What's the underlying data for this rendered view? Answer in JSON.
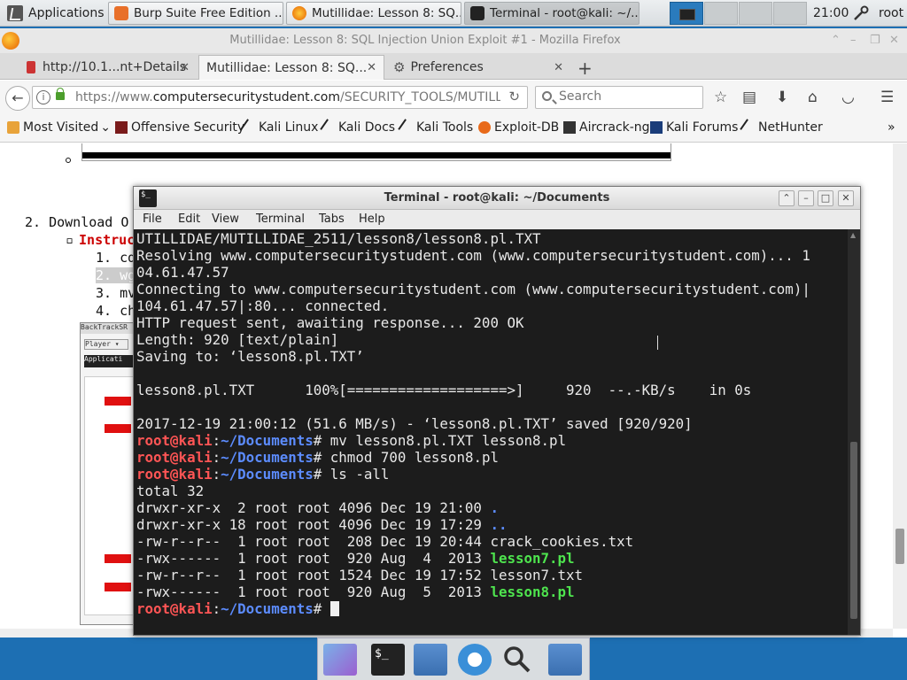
{
  "panel": {
    "applications": "Applications",
    "tasks": [
      {
        "label": "Burp Suite Free Edition ...",
        "color": "#e8702a"
      },
      {
        "label": "Mutillidae: Lesson 8: SQ...",
        "color": "#e66000"
      },
      {
        "label": "Terminal - root@kali: ~/...",
        "color": "#222222"
      }
    ],
    "clock": "21:00",
    "user": "root"
  },
  "firefox": {
    "window_title": "Mutillidae: Lesson 8: SQL Injection Union Exploit #1 - Mozilla Firefox",
    "tabs": [
      {
        "label": "http://10.1...nt+Details",
        "close": "✕"
      },
      {
        "label": "Mutillidae: Lesson 8: SQ...",
        "close": "✕"
      },
      {
        "label": "Preferences",
        "close": "✕"
      }
    ],
    "new_tab": "+",
    "url_host": "https://www.",
    "url_domain": "computersecuritystudent.com",
    "url_path": "/SECURITY_TOOLS/MUTILLI",
    "search_placeholder": "Search",
    "bookmarks": [
      {
        "label": "Most Visited",
        "icon": "gear-icon",
        "suffix": "⌄"
      },
      {
        "label": "Offensive Security",
        "icon": "offsec-icon"
      },
      {
        "label": "Kali Linux",
        "icon": "kali-dragon-icon"
      },
      {
        "label": "Kali Docs",
        "icon": "kali-dragon-icon"
      },
      {
        "label": "Kali Tools",
        "icon": "kali-dragon-icon"
      },
      {
        "label": "Exploit-DB",
        "icon": "exploitdb-icon"
      },
      {
        "label": "Aircrack-ng",
        "icon": "aircrack-icon"
      },
      {
        "label": "Kali Forums",
        "icon": "kali-forums-icon"
      },
      {
        "label": "NetHunter",
        "icon": "kali-dragon-icon"
      }
    ],
    "bookmarks_more": "»",
    "page": {
      "download_item": "2. Download O",
      "instructions_label": "Instruc",
      "steps": [
        "1. cd",
        "2. wge",
        "3. mv",
        "4. chm"
      ],
      "thumb_title": "BackTrackSR",
      "thumb_applicat": "Applicati",
      "thumb_player": "Player ▾"
    }
  },
  "terminal": {
    "title": "Terminal - root@kali: ~/Documents",
    "menu": [
      "File",
      "Edit",
      "View",
      "Terminal",
      "Tabs",
      "Help"
    ],
    "prompt_user": "root@kali",
    "prompt_path": "~/Documents",
    "lines": [
      "UTILLIDAE/MUTILLIDAE_2511/lesson8/lesson8.pl.TXT",
      "Resolving www.computersecuritystudent.com (www.computersecuritystudent.com)... 1",
      "04.61.47.57",
      "Connecting to www.computersecuritystudent.com (www.computersecuritystudent.com)|",
      "104.61.47.57|:80... connected.",
      "HTTP request sent, awaiting response... 200 OK",
      "Length: 920 [text/plain]",
      "Saving to: ‘lesson8.pl.TXT’",
      "",
      "lesson8.pl.TXT      100%[===================>]     920  --.-KB/s    in 0s",
      "",
      "2017-12-19 21:00:12 (51.6 MB/s) - ‘lesson8.pl.TXT’ saved [920/920]",
      ""
    ],
    "commands": [
      "mv lesson8.pl.TXT lesson8.pl",
      "chmod 700 lesson8.pl",
      "ls -all"
    ],
    "total": "total 32",
    "listing": [
      {
        "meta": "drwxr-xr-x  2 root root 4096 Dec 19 21:00 ",
        "name": ".",
        "kind": "dir"
      },
      {
        "meta": "drwxr-xr-x 18 root root 4096 Dec 19 17:29 ",
        "name": "..",
        "kind": "dir"
      },
      {
        "meta": "-rw-r--r--  1 root root  208 Dec 19 20:44 ",
        "name": "crack_cookies.txt",
        "kind": "file"
      },
      {
        "meta": "-rwx------  1 root root  920 Aug  4  2013 ",
        "name": "lesson7.pl",
        "kind": "exec"
      },
      {
        "meta": "-rw-r--r--  1 root root 1524 Dec 19 17:52 ",
        "name": "lesson7.txt",
        "kind": "file"
      },
      {
        "meta": "-rwx------  1 root root  920 Aug  5  2013 ",
        "name": "lesson8.pl",
        "kind": "exec"
      }
    ]
  },
  "dock": [
    {
      "name": "desktop-icon"
    },
    {
      "name": "terminal-icon"
    },
    {
      "name": "files-icon"
    },
    {
      "name": "browser-icon"
    },
    {
      "name": "search-icon"
    },
    {
      "name": "folder-icon"
    }
  ]
}
